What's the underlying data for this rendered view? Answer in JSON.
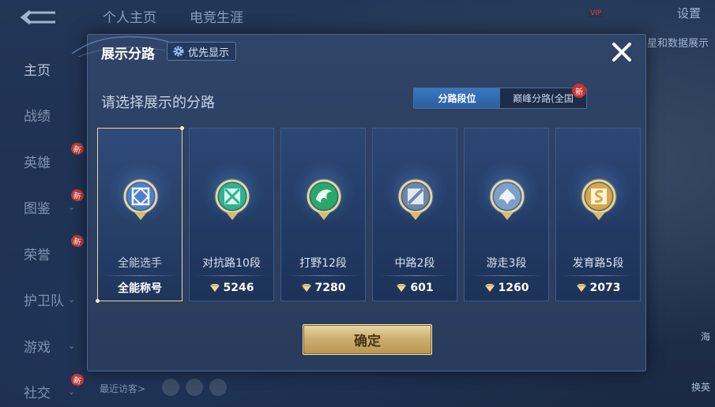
{
  "background": {
    "top_tabs": [
      "个人主页",
      "电竞生涯"
    ],
    "settings_label": "设置",
    "vip_label": "VIP",
    "top_right_text": "星和数据展示",
    "sidebar": [
      {
        "label": "主页",
        "active": true,
        "chevron": false,
        "new": false
      },
      {
        "label": "战绩",
        "active": false,
        "chevron": false,
        "new": false
      },
      {
        "label": "英雄",
        "active": false,
        "chevron": false,
        "new": true
      },
      {
        "label": "图鉴",
        "active": false,
        "chevron": true,
        "new": true
      },
      {
        "label": "荣誉",
        "active": false,
        "chevron": false,
        "new": true
      },
      {
        "label": "护卫队",
        "active": false,
        "chevron": true,
        "new": false
      },
      {
        "label": "游戏",
        "active": false,
        "chevron": true,
        "new": false
      },
      {
        "label": "社交",
        "active": false,
        "chevron": true,
        "new": true
      }
    ],
    "new_tag": "新",
    "recent_visitors": "最近访客>",
    "right_labels": [
      "海",
      "换英"
    ]
  },
  "dialog": {
    "title": "展示分路",
    "priority_label": "优先显示",
    "close_label": "✕",
    "subtitle": "请选择展示的分路",
    "toggle": {
      "options": [
        "分路段位",
        "巅峰分路(全国"
      ],
      "active_index": 0,
      "new_badge": "新"
    },
    "cards": [
      {
        "label": "全能选手",
        "value": "全能称号",
        "selected": true,
        "emblem": "all-round",
        "color": "#4d7fd0",
        "show_gem": false
      },
      {
        "label": "对抗路10段",
        "value": "5246",
        "selected": false,
        "emblem": "clash-lane",
        "color": "#2fb38e",
        "show_gem": true
      },
      {
        "label": "打野12段",
        "value": "7280",
        "selected": false,
        "emblem": "jungle",
        "color": "#2aa76a",
        "show_gem": true
      },
      {
        "label": "中路2段",
        "value": "601",
        "selected": false,
        "emblem": "mid-lane",
        "color": "#6f87a6",
        "show_gem": true
      },
      {
        "label": "游走3段",
        "value": "1260",
        "selected": false,
        "emblem": "roam",
        "color": "#7fa0c6",
        "show_gem": true
      },
      {
        "label": "发育路5段",
        "value": "2073",
        "selected": false,
        "emblem": "farm-lane",
        "color": "#d9a845",
        "show_gem": true
      }
    ],
    "confirm_label": "确定"
  }
}
